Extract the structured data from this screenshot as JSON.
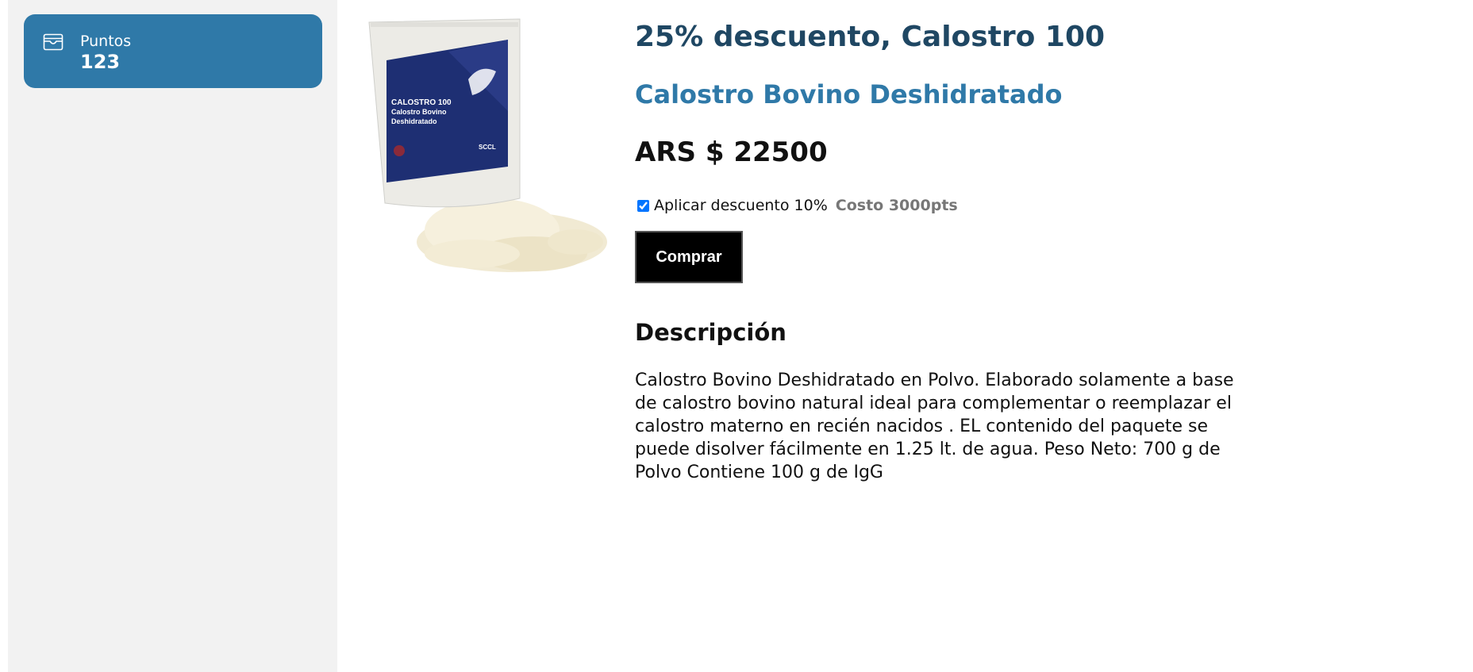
{
  "sidebar": {
    "points_label": "Puntos",
    "points_value": "123",
    "icon": "wallet-icon",
    "card_color": "#2f79a8"
  },
  "product": {
    "promo_title": "25% descuento, Calostro 100",
    "name": "Calostro Bovino Deshidratado",
    "price": "ARS $ 22500",
    "image_alt": "Calostro Bovino Deshidratado",
    "image_text": {
      "line1": "CALOSTRO 100",
      "line2": "Calostro Bovino",
      "line3": "Deshidratado",
      "brand": "SCCL"
    },
    "discount": {
      "label": "Aplicar descuento 10%",
      "cost": "Costo 3000pts",
      "checked": true
    },
    "buy_label": "Comprar",
    "description_heading": "Descripción",
    "description": "Calostro Bovino Deshidratado en Polvo. Elaborado solamente a base de calostro bovino natural ideal para complementar o reemplazar el calostro materno en recién nacidos . EL contenido del paquete se puede disolver fácilmente en 1.25 lt. de agua. Peso Neto: 700 g de Polvo Contiene 100 g de IgG"
  },
  "colors": {
    "title": "#1f4763",
    "accent": "#2f79a8",
    "sidebar_bg": "#f2f2f2",
    "muted": "#777777"
  }
}
